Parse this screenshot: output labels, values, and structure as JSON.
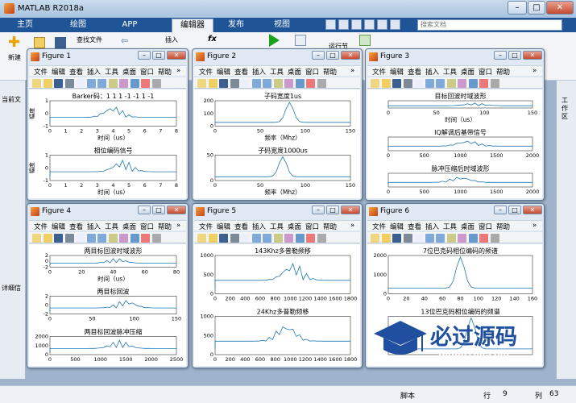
{
  "app": {
    "title": "MATLAB R2018a"
  },
  "tabs": [
    "主页",
    "绘图",
    "APP",
    "编辑器",
    "发布",
    "视图"
  ],
  "search": {
    "placeholder": "搜索文档"
  },
  "ribbon": {
    "new": "新建",
    "find_files": "查找文件",
    "insert": "插入",
    "fx": "fx",
    "run_section": "运行节"
  },
  "left_pane": {
    "current": "当前文",
    "detail": "详细信"
  },
  "right_pane": {
    "label": "工作区"
  },
  "status": {
    "mode": "脚本",
    "row_label": "行",
    "row": "9",
    "col_label": "列",
    "col": "63"
  },
  "figure_menu": [
    "文件",
    "编辑",
    "查看",
    "插入",
    "工具",
    "桌面",
    "窗口",
    "帮助"
  ],
  "figures": [
    {
      "title": "Figure 1",
      "plots": [
        {
          "title": "Barker码：1 1 1 -1 -1 1 -1",
          "xlabel": "时间（us）",
          "ylabel": "幅度",
          "xticks": [
            "0",
            "1",
            "2",
            "3",
            "4",
            "5",
            "6",
            "7",
            "8"
          ],
          "yticks": [
            "1",
            "0",
            "-1"
          ]
        },
        {
          "title": "相位编码信号",
          "xlabel": "时间（us）",
          "ylabel": "幅度",
          "xticks": [
            "0",
            "1",
            "2",
            "3",
            "4",
            "5",
            "6",
            "7",
            "8"
          ],
          "yticks": [
            "1",
            "0",
            "-1"
          ]
        }
      ]
    },
    {
      "title": "Figure 2",
      "plots": [
        {
          "title": "子码宽度1us",
          "xlabel": "频率（Mhz）",
          "ylabel": "",
          "xticks": [
            "0",
            "50",
            "100",
            "150"
          ],
          "yticks": [
            "200",
            "100",
            "0"
          ]
        },
        {
          "title": "子码宽度1000us",
          "xlabel": "频率（Mhz）",
          "ylabel": "",
          "xticks": [
            "0",
            "50",
            "100",
            "150"
          ],
          "yticks": [
            "50",
            "0"
          ]
        }
      ]
    },
    {
      "title": "Figure 3",
      "plots": [
        {
          "title": "目标回波时域波形",
          "xlabel": "时间（us）",
          "ylabel": "",
          "xticks": [
            "0",
            "50",
            "100",
            "150"
          ],
          "yticks": []
        },
        {
          "title": "IQ解调后基带信号",
          "xlabel": "",
          "ylabel": "",
          "xticks": [
            "0",
            "500",
            "1000",
            "1500",
            "2000"
          ],
          "yticks": []
        },
        {
          "title": "脉冲压缩后时域波形",
          "xlabel": "",
          "ylabel": "",
          "xticks": [
            "0",
            "500",
            "1000",
            "1500",
            "2000"
          ],
          "yticks": []
        }
      ]
    },
    {
      "title": "Figure 4",
      "plots": [
        {
          "title": "两目标回波时域波形",
          "xlabel": "时间（us）",
          "ylabel": "",
          "xticks": [
            "0",
            "20",
            "40",
            "60",
            "80"
          ],
          "yticks": [
            "2",
            "0",
            "-2"
          ]
        },
        {
          "title": "两目标回波",
          "xlabel": "",
          "ylabel": "",
          "xticks": [
            "0",
            "50",
            "100",
            "150"
          ],
          "yticks": [
            "2",
            "0",
            "-2"
          ]
        },
        {
          "title": "两目标回波脉冲压缩",
          "xlabel": "",
          "ylabel": "",
          "xticks": [
            "0",
            "500",
            "1000",
            "1500",
            "2000",
            "2500"
          ],
          "yticks": [
            "2000",
            "1000",
            "0"
          ]
        }
      ]
    },
    {
      "title": "Figure 5",
      "plots": [
        {
          "title": "143Khz多普勒频移",
          "xlabel": "",
          "ylabel": "",
          "xticks": [
            "0",
            "200",
            "400",
            "600",
            "800",
            "1000",
            "1200",
            "1400",
            "1600",
            "1800"
          ],
          "yticks": [
            "1000",
            "500",
            "0"
          ]
        },
        {
          "title": "24Khz多普勒频移",
          "xlabel": "",
          "ylabel": "",
          "xticks": [
            "0",
            "200",
            "400",
            "600",
            "800",
            "1000",
            "1200",
            "1400",
            "1600",
            "1800"
          ],
          "yticks": [
            "1000",
            "500",
            "0"
          ]
        }
      ]
    },
    {
      "title": "Figure 6",
      "plots": [
        {
          "title": "7位巴克码相位编码的频谱",
          "xlabel": "",
          "ylabel": "",
          "xticks": [
            "0",
            "20",
            "40",
            "60",
            "80",
            "100",
            "120",
            "140",
            "160"
          ],
          "yticks": [
            "2000",
            "1000",
            "0"
          ]
        },
        {
          "title": "13位巴克码相位编码的频谱",
          "xlabel": "",
          "ylabel": "",
          "xticks": [],
          "yticks": []
        }
      ]
    }
  ],
  "watermark": {
    "text": "必过源码",
    "url": "Biguo100.com"
  }
}
